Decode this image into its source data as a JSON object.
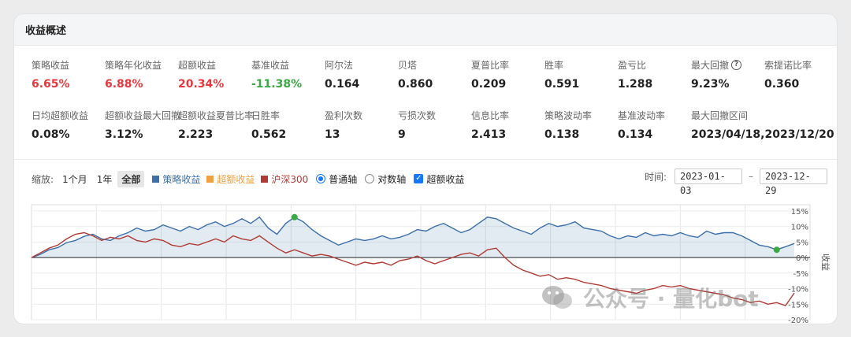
{
  "header": {
    "title": "收益概述"
  },
  "metrics_row1": [
    {
      "label": "策略收益",
      "value": "6.65%",
      "color": "red"
    },
    {
      "label": "策略年化收益",
      "value": "6.88%",
      "color": "red"
    },
    {
      "label": "超额收益",
      "value": "20.34%",
      "color": "red"
    },
    {
      "label": "基准收益",
      "value": "-11.38%",
      "color": "green"
    },
    {
      "label": "阿尔法",
      "value": "0.164",
      "color": ""
    },
    {
      "label": "贝塔",
      "value": "0.860",
      "color": ""
    },
    {
      "label": "夏普比率",
      "value": "0.209",
      "color": ""
    },
    {
      "label": "胜率",
      "value": "0.591",
      "color": ""
    },
    {
      "label": "盈亏比",
      "value": "1.288",
      "color": ""
    },
    {
      "label": "最大回撤",
      "value": "9.23%",
      "color": "",
      "help": true
    },
    {
      "label": "索提诺比率",
      "value": "0.360",
      "color": ""
    }
  ],
  "metrics_row2": [
    {
      "label": "日均超额收益",
      "value": "0.08%"
    },
    {
      "label": "超额收益最大回撤",
      "value": "3.12%"
    },
    {
      "label": "超额收益夏普比率",
      "value": "2.223"
    },
    {
      "label": "日胜率",
      "value": "0.562"
    },
    {
      "label": "盈利次数",
      "value": "13"
    },
    {
      "label": "亏损次数",
      "value": "9"
    },
    {
      "label": "信息比率",
      "value": "2.413"
    },
    {
      "label": "策略波动率",
      "value": "0.138"
    },
    {
      "label": "基准波动率",
      "value": "0.134"
    },
    {
      "label": "最大回撤区间",
      "value": "2023/04/18,2023/12/20"
    }
  ],
  "toolbar": {
    "zoom_label": "缩放:",
    "zoom_1m": "1个月",
    "zoom_1y": "1年",
    "zoom_all": "全部",
    "legend_strategy": "策略收益",
    "legend_excess": "超额收益",
    "legend_benchmark": "沪深300",
    "axis_normal": "普通轴",
    "axis_log": "对数轴",
    "show_excess": "超额收益",
    "time_label": "时间:",
    "start_date": "2023-01-03",
    "end_date": "2023-12-29"
  },
  "watermark": {
    "text": "公众号 · 量化bot"
  },
  "colors": {
    "strategy": "#3d6fa8",
    "excess": "#f0a040",
    "benchmark": "#b03a34",
    "red": "#e8383d",
    "green": "#3aa845",
    "marker": "#3aa845"
  },
  "chart_data": {
    "type": "line",
    "x_range": [
      "2023-01-03",
      "2023-12-29"
    ],
    "ylabel": "收益",
    "ylim": [
      -20,
      17
    ],
    "yticks": [
      15,
      10,
      5,
      0,
      -5,
      -10,
      -15,
      -20
    ],
    "series": [
      {
        "name": "策略收益",
        "values": [
          0,
          1,
          2.5,
          3.2,
          4.8,
          5.5,
          6.8,
          7.5,
          6.0,
          5.5,
          7.0,
          8.0,
          9.5,
          8.5,
          9.0,
          10.5,
          9.5,
          8.5,
          10.0,
          9.0,
          10.5,
          11.5,
          10.0,
          11.0,
          12.5,
          11.0,
          13.0,
          9.5,
          7.5,
          11.0,
          13.0,
          11.5,
          9.0,
          7.0,
          5.5,
          4.0,
          5.0,
          6.0,
          5.5,
          6.0,
          7.0,
          6.0,
          6.5,
          7.5,
          9.0,
          8.5,
          10.0,
          11.0,
          9.5,
          8.0,
          9.0,
          11.0,
          13.0,
          12.5,
          11.0,
          9.5,
          8.5,
          7.5,
          9.5,
          11.0,
          10.0,
          10.5,
          11.5,
          9.5,
          9.0,
          8.5,
          7.0,
          6.0,
          7.0,
          6.5,
          8.0,
          7.0,
          7.5,
          7.0,
          8.0,
          7.0,
          6.5,
          8.5,
          7.5,
          8.0,
          8.0,
          7.0,
          5.5,
          4.0,
          3.5,
          2.5,
          3.5,
          4.5
        ],
        "color": "#3d6fa8"
      },
      {
        "name": "沪深300",
        "values": [
          0,
          1.5,
          3.0,
          4.0,
          6.0,
          7.5,
          8.0,
          7.0,
          5.5,
          6.5,
          6.0,
          7.0,
          5.5,
          5.0,
          6.0,
          5.5,
          4.0,
          3.5,
          4.5,
          4.0,
          5.0,
          6.0,
          5.0,
          7.0,
          6.0,
          5.5,
          7.0,
          5.0,
          3.0,
          1.5,
          2.5,
          1.5,
          0.5,
          1.0,
          0.5,
          -0.5,
          -1.5,
          -2.5,
          -1.5,
          -2.0,
          -1.5,
          -2.5,
          -1.0,
          -0.5,
          0.5,
          -1.0,
          -2.0,
          -1.0,
          0,
          1.0,
          1.5,
          0.5,
          2.5,
          3.0,
          0,
          -2.5,
          -4.0,
          -5.0,
          -6.0,
          -5.5,
          -7.0,
          -6.5,
          -7.0,
          -8.0,
          -8.5,
          -9.0,
          -10.0,
          -10.5,
          -11.0,
          -11.5,
          -10.5,
          -10.0,
          -9.0,
          -9.5,
          -9.0,
          -10.0,
          -10.5,
          -11.0,
          -11.5,
          -12.0,
          -13.0,
          -13.5,
          -14.5,
          -14.0,
          -15.0,
          -14.5,
          -15.5,
          -11.4
        ],
        "color": "#b03a34"
      }
    ],
    "markers": [
      {
        "series": "策略收益",
        "index": 30
      },
      {
        "series": "策略收益",
        "index": 85
      }
    ]
  }
}
